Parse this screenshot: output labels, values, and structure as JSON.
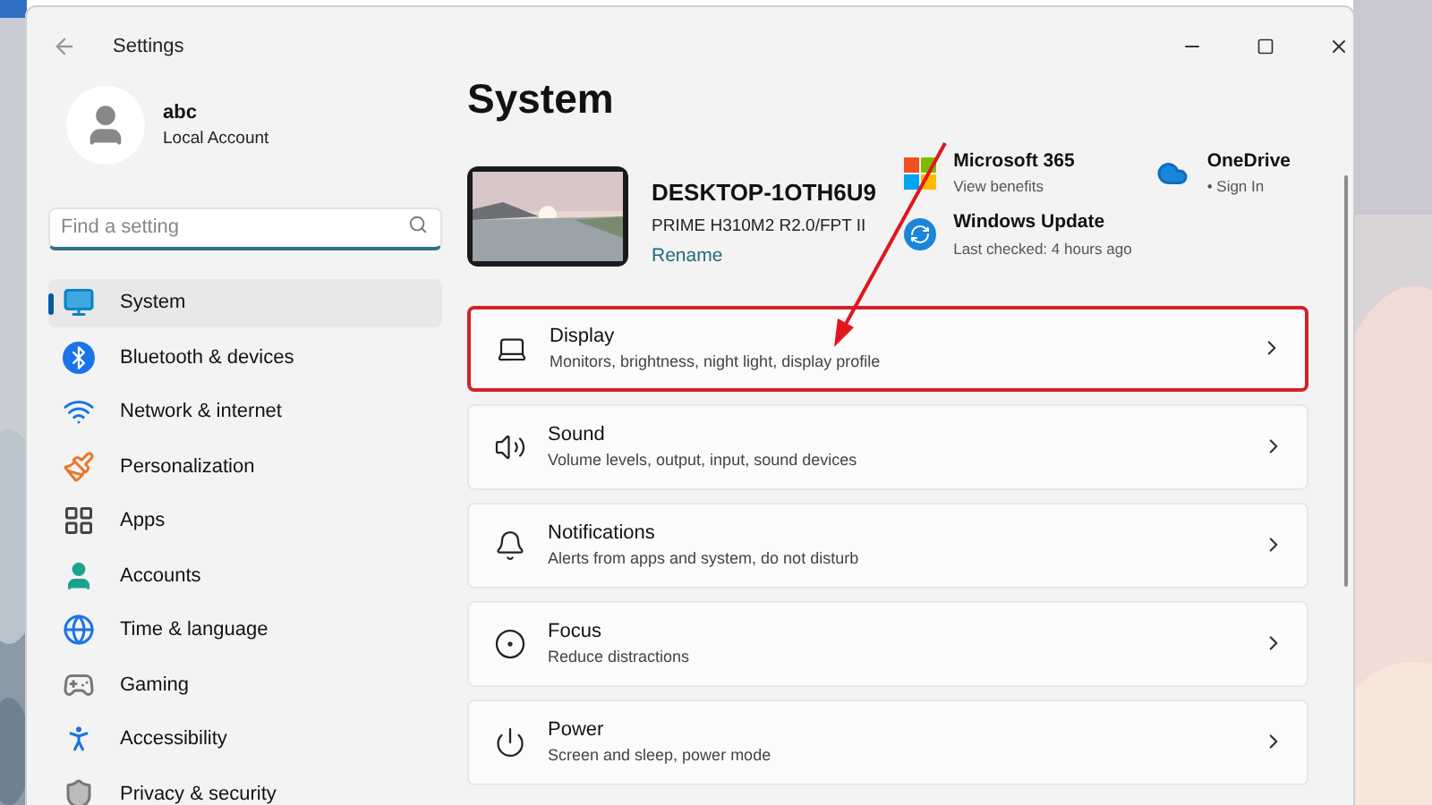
{
  "window": {
    "title": "Settings"
  },
  "account": {
    "name": "abc",
    "type": "Local Account"
  },
  "search": {
    "placeholder": "Find a setting"
  },
  "sidebar": {
    "items": [
      {
        "label": "System",
        "selected": true
      },
      {
        "label": "Bluetooth & devices",
        "selected": false
      },
      {
        "label": "Network & internet",
        "selected": false
      },
      {
        "label": "Personalization",
        "selected": false
      },
      {
        "label": "Apps",
        "selected": false
      },
      {
        "label": "Accounts",
        "selected": false
      },
      {
        "label": "Time & language",
        "selected": false
      },
      {
        "label": "Gaming",
        "selected": false
      },
      {
        "label": "Accessibility",
        "selected": false
      },
      {
        "label": "Privacy & security",
        "selected": false
      }
    ]
  },
  "page": {
    "title": "System"
  },
  "device": {
    "name": "DESKTOP-1OTH6U9",
    "model": "PRIME H310M2 R2.0/FPT II",
    "link": "Rename"
  },
  "services": [
    {
      "title": "Microsoft 365",
      "subtitle": "View benefits"
    },
    {
      "title": "OneDrive",
      "subtitle": "• Sign In"
    },
    {
      "title": "Windows Update",
      "subtitle": "Last checked: 4 hours ago"
    }
  ],
  "settings": [
    {
      "title": "Display",
      "subtitle": "Monitors, brightness, night light, display profile",
      "highlighted": true
    },
    {
      "title": "Sound",
      "subtitle": "Volume levels, output, input, sound devices",
      "highlighted": false
    },
    {
      "title": "Notifications",
      "subtitle": "Alerts from apps and system, do not disturb",
      "highlighted": false
    },
    {
      "title": "Focus",
      "subtitle": "Reduce distractions",
      "highlighted": false
    },
    {
      "title": "Power",
      "subtitle": "Screen and sleep, power mode",
      "highlighted": false
    }
  ]
}
